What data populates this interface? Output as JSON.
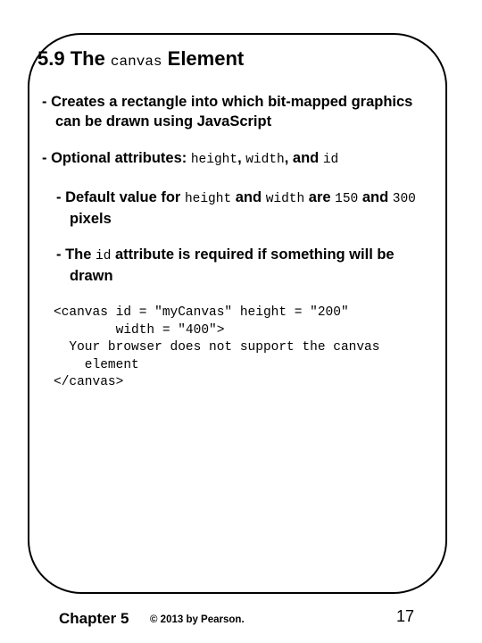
{
  "slide": {
    "title": {
      "prefix": "5.9 The ",
      "code": "canvas",
      "suffix": " Element"
    },
    "bullets": [
      {
        "line1": "- Creates a rectangle into which bit-mapped graphics",
        "line2": "can be drawn using JavaScript"
      },
      {
        "t1": "- Optional attributes: ",
        "c1": "height",
        "t2": ", ",
        "c2": "width",
        "t3": ", and ",
        "c3": "id"
      },
      {
        "t1": "- Default value for ",
        "c1": "height",
        "t2": " and ",
        "c2": "width",
        "t3": " are ",
        "c3": "150",
        "t4": " and ",
        "c4": "300",
        "line2": "pixels"
      },
      {
        "t1": "- The ",
        "c1": "id",
        "t2": " attribute is required if something will be",
        "line2": "drawn"
      }
    ],
    "code_lines": [
      "<canvas id = \"myCanvas\" height = \"200\"",
      "        width = \"400\">",
      "  Your browser does not support the canvas",
      "    element",
      "</canvas>"
    ]
  },
  "footer": {
    "chapter": "Chapter 5",
    "copyright": "© 2013 by Pearson.",
    "page_number": "17"
  }
}
